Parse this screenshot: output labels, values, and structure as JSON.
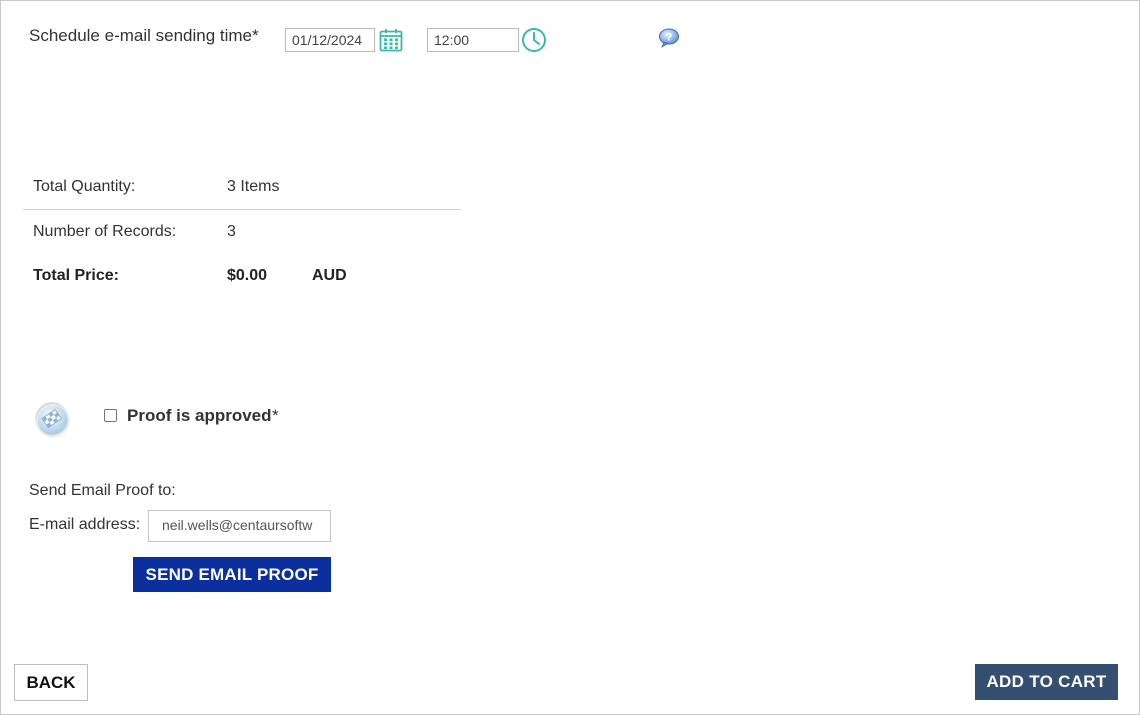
{
  "schedule": {
    "label": "Schedule e-mail sending time*",
    "date_value": "01/12/2024",
    "time_value": "12:00",
    "calendar_icon": "calendar-icon",
    "clock_icon": "clock-icon",
    "help_icon": "help-bubble-icon",
    "accent_color": "#3ab8a8"
  },
  "totals": {
    "quantity_label": "Total Quantity:",
    "quantity_value": "3 Items",
    "records_label": "Number of Records:",
    "records_value": "3",
    "price_label": "Total Price:",
    "price_value": "$0.00",
    "currency": "AUD"
  },
  "proof": {
    "badge_icon": "proof-badge-icon",
    "approved_label": "Proof is approved",
    "required_mark": "*",
    "approved_checked": false
  },
  "email_proof": {
    "send_to_label": "Send Email Proof to:",
    "email_label": "E-mail address:",
    "email_value": "neil.wells@centaursoftw",
    "send_button": "SEND EMAIL PROOF",
    "button_color": "#0b2f9c"
  },
  "footer": {
    "back_button": "BACK",
    "add_to_cart_button": "ADD TO CART",
    "cart_button_color": "#354f71"
  }
}
